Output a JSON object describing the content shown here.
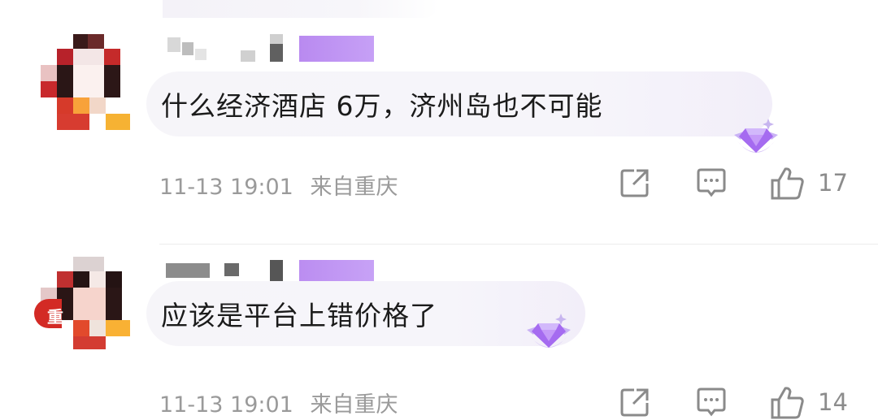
{
  "comments": [
    {
      "text": "什么经济酒店 6万，济州岛也不可能",
      "timestamp": "11-13 19:01",
      "location": "来自重庆",
      "likes": "17",
      "badge_icon": "diamond-badge-icon"
    },
    {
      "avatar_text": "重",
      "text": "应该是平台上错价格了",
      "timestamp": "11-13 19:01",
      "location": "来自重庆",
      "likes": "14",
      "badge_icon": "diamond-badge-icon"
    }
  ],
  "colors": {
    "meta_text": "#9a9a9a",
    "badge_purple": "#b07cf2",
    "name_block_purple": "#b98af0"
  }
}
